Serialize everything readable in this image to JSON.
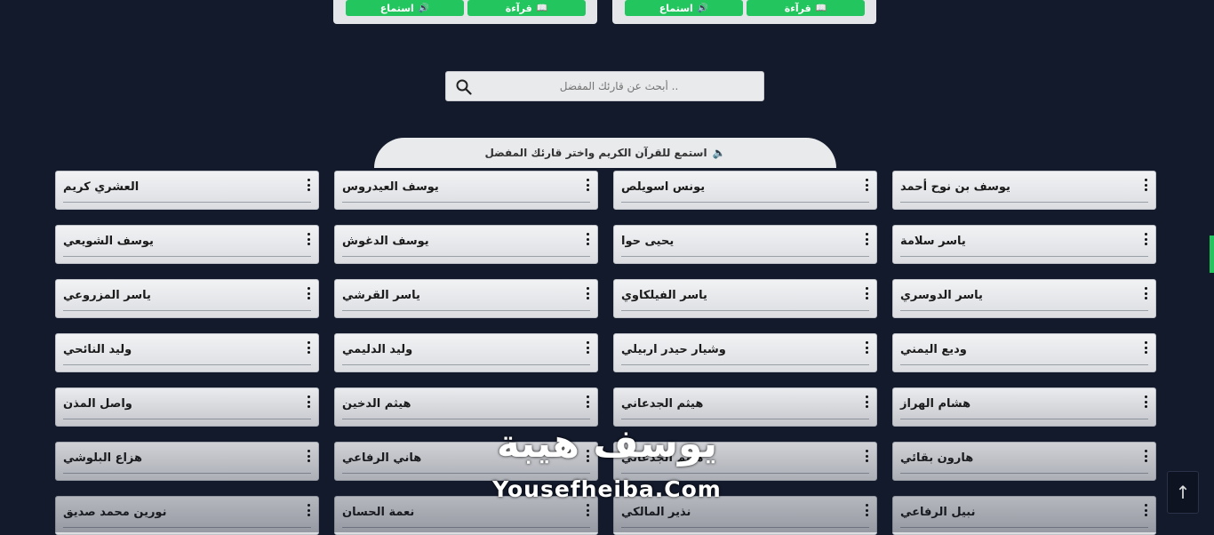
{
  "top_cards": [
    {
      "read_label": "قرآءة",
      "listen_label": "استماع"
    },
    {
      "read_label": "قرآءة",
      "listen_label": "استماع"
    }
  ],
  "search": {
    "placeholder": "أبحث عن قارئك المفضل .."
  },
  "tab_header": {
    "label": "استمع للقرآن الكريم واختر قارئك المفضل"
  },
  "reciters": [
    "العشري كريم",
    "يوسف العيدروس",
    "يونس اسويلص",
    "يوسف بن نوح أحمد",
    "يوسف الشويعي",
    "يوسف الدغوش",
    "يحيى حوا",
    "ياسر سلامة",
    "ياسر المزروعي",
    "ياسر القرشي",
    "ياسر الفيلكاوي",
    "ياسر الدوسري",
    "وليد النائحي",
    "وليد الدليمي",
    "وشيار حيدر اربيلي",
    "وديع اليمني",
    "واصل المذن",
    "هيثم الدخين",
    "هيثم الجدعاني",
    "هشام الهراز",
    "هزاع البلوشي",
    "هاني الرفاعي",
    "هيثم الجدعاني",
    "هارون بقائي",
    "نورين محمد صديق",
    "نعمة الحسان",
    "نذير المالكي",
    "نبيل الرفاعي"
  ],
  "watermark": {
    "arabic": "يوسف هيبة",
    "latin": "Yousefheiba.Com"
  },
  "scroll_top_icon": "arrow-up-icon",
  "colors": {
    "background": "#131a2c",
    "accent": "#22c55e",
    "card": "#e9eaec"
  }
}
